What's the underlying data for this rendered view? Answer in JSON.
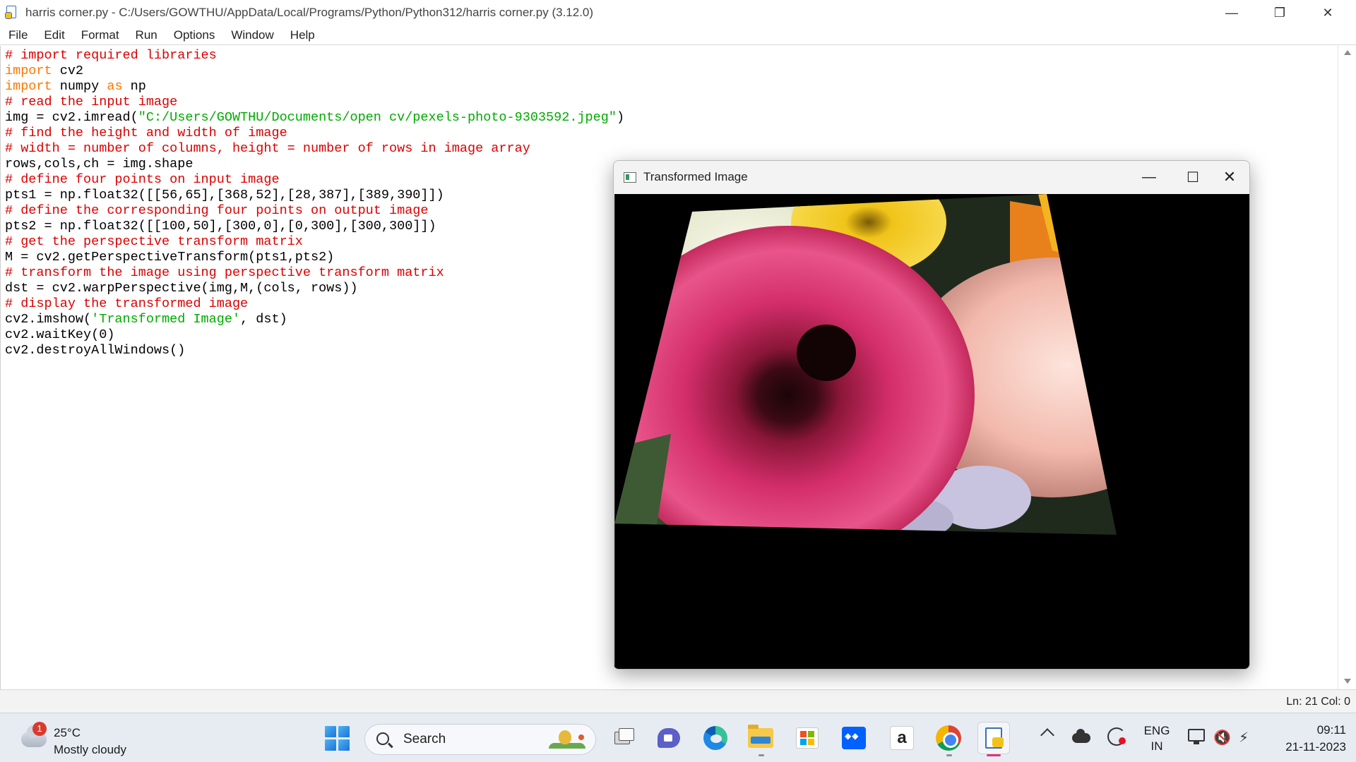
{
  "window": {
    "title": "harris corner.py - C:/Users/GOWTHU/AppData/Local/Programs/Python/Python312/harris corner.py (3.12.0)",
    "controls": {
      "minimize": "—",
      "maximize": "❐",
      "close": "✕"
    }
  },
  "menu": [
    "File",
    "Edit",
    "Format",
    "Run",
    "Options",
    "Window",
    "Help"
  ],
  "code_lines": [
    [
      {
        "t": "# import required libraries",
        "k": "comment"
      }
    ],
    [
      {
        "t": "import",
        "k": "keyword"
      },
      {
        "t": " cv2",
        "k": "plain"
      }
    ],
    [
      {
        "t": "import",
        "k": "keyword"
      },
      {
        "t": " numpy ",
        "k": "plain"
      },
      {
        "t": "as",
        "k": "keyword"
      },
      {
        "t": " np",
        "k": "plain"
      }
    ],
    [
      {
        "t": "# read the input image",
        "k": "comment"
      }
    ],
    [
      {
        "t": "img = cv2.imread(",
        "k": "plain"
      },
      {
        "t": "\"C:/Users/GOWTHU/Documents/open cv/pexels-photo-9303592.jpeg\"",
        "k": "string"
      },
      {
        "t": ")",
        "k": "plain"
      }
    ],
    [
      {
        "t": "# find the height and width of image",
        "k": "comment"
      }
    ],
    [
      {
        "t": "# width = number of columns, height = number of rows in image array",
        "k": "comment"
      }
    ],
    [
      {
        "t": "rows,cols,ch = img.shape",
        "k": "plain"
      }
    ],
    [
      {
        "t": "# define four points on input image",
        "k": "comment"
      }
    ],
    [
      {
        "t": "pts1 = np.float32([[56,65],[368,52],[28,387],[389,390]])",
        "k": "plain"
      }
    ],
    [
      {
        "t": "# define the corresponding four points on output image",
        "k": "comment"
      }
    ],
    [
      {
        "t": "pts2 = np.float32([[100,50],[300,0],[0,300],[300,300]])",
        "k": "plain"
      }
    ],
    [
      {
        "t": "# get the perspective transform matrix",
        "k": "comment"
      }
    ],
    [
      {
        "t": "M = cv2.getPerspectiveTransform(pts1,pts2)",
        "k": "plain"
      }
    ],
    [
      {
        "t": "# transform the image using perspective transform matrix",
        "k": "comment"
      }
    ],
    [
      {
        "t": "dst = cv2.warpPerspective(img,M,(cols, rows))",
        "k": "plain"
      }
    ],
    [
      {
        "t": "# display the transformed image",
        "k": "comment"
      }
    ],
    [
      {
        "t": "cv2.imshow(",
        "k": "plain"
      },
      {
        "t": "'Transformed Image'",
        "k": "string"
      },
      {
        "t": ", dst)",
        "k": "plain"
      }
    ],
    [
      {
        "t": "cv2.waitKey(0)",
        "k": "plain"
      }
    ],
    [
      {
        "t": "cv2.destroyAllWindows()",
        "k": "plain"
      }
    ]
  ],
  "syntax_colors": {
    "comment": "#dd0000",
    "keyword": "#ff7700",
    "string": "#00aa00",
    "plain": "#000000"
  },
  "status": {
    "position": "Ln: 21   Col: 0"
  },
  "cv_window": {
    "title": "Transformed Image",
    "controls": {
      "minimize": "—",
      "maximize": "☐",
      "close": "✕"
    }
  },
  "taskbar": {
    "weather": {
      "badge": "1",
      "temp": "25°C",
      "condition": "Mostly cloudy"
    },
    "search_label": "Search",
    "amazon_glyph": "a",
    "volume_glyph": "🔇",
    "battery_glyph": "⚡",
    "language": {
      "line1": "ENG",
      "line2": "IN"
    },
    "time": "09:11",
    "date": "21-11-2023",
    "icons": [
      "start-icon",
      "search-icon",
      "task-view-icon",
      "teams-chat-icon",
      "edge-icon",
      "file-explorer-icon",
      "microsoft-store-icon",
      "dropbox-icon",
      "amazon-icon",
      "chrome-icon",
      "idle-icon"
    ]
  }
}
